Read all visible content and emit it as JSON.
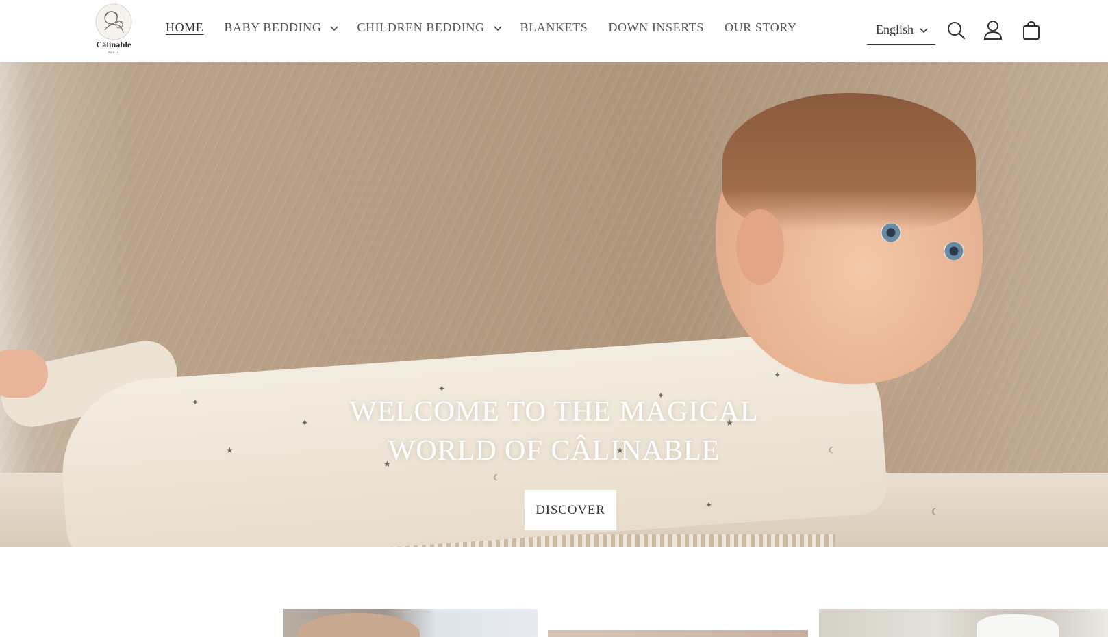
{
  "brand": {
    "name": "Câlinable",
    "tagline": "PARIS"
  },
  "nav": {
    "items": [
      {
        "label": "HOME",
        "active": true,
        "has_dropdown": false
      },
      {
        "label": "BABY BEDDING",
        "active": false,
        "has_dropdown": true
      },
      {
        "label": "CHILDREN BEDDING",
        "active": false,
        "has_dropdown": true
      },
      {
        "label": "BLANKETS",
        "active": false,
        "has_dropdown": false
      },
      {
        "label": "DOWN INSERTS",
        "active": false,
        "has_dropdown": false
      },
      {
        "label": "OUR STORY",
        "active": false,
        "has_dropdown": false
      }
    ]
  },
  "header": {
    "language": "English",
    "icons": [
      "search-icon",
      "account-icon",
      "cart-icon"
    ]
  },
  "hero": {
    "title_line1": "WELCOME TO THE MAGICAL",
    "title_line2": "WORLD OF CÂLINABLE",
    "cta_label": "DISCOVER"
  },
  "colors": {
    "text": "#333333",
    "nav_text": "#555555",
    "hero_bg": "#b59d83",
    "button_bg": "#ffffff"
  }
}
